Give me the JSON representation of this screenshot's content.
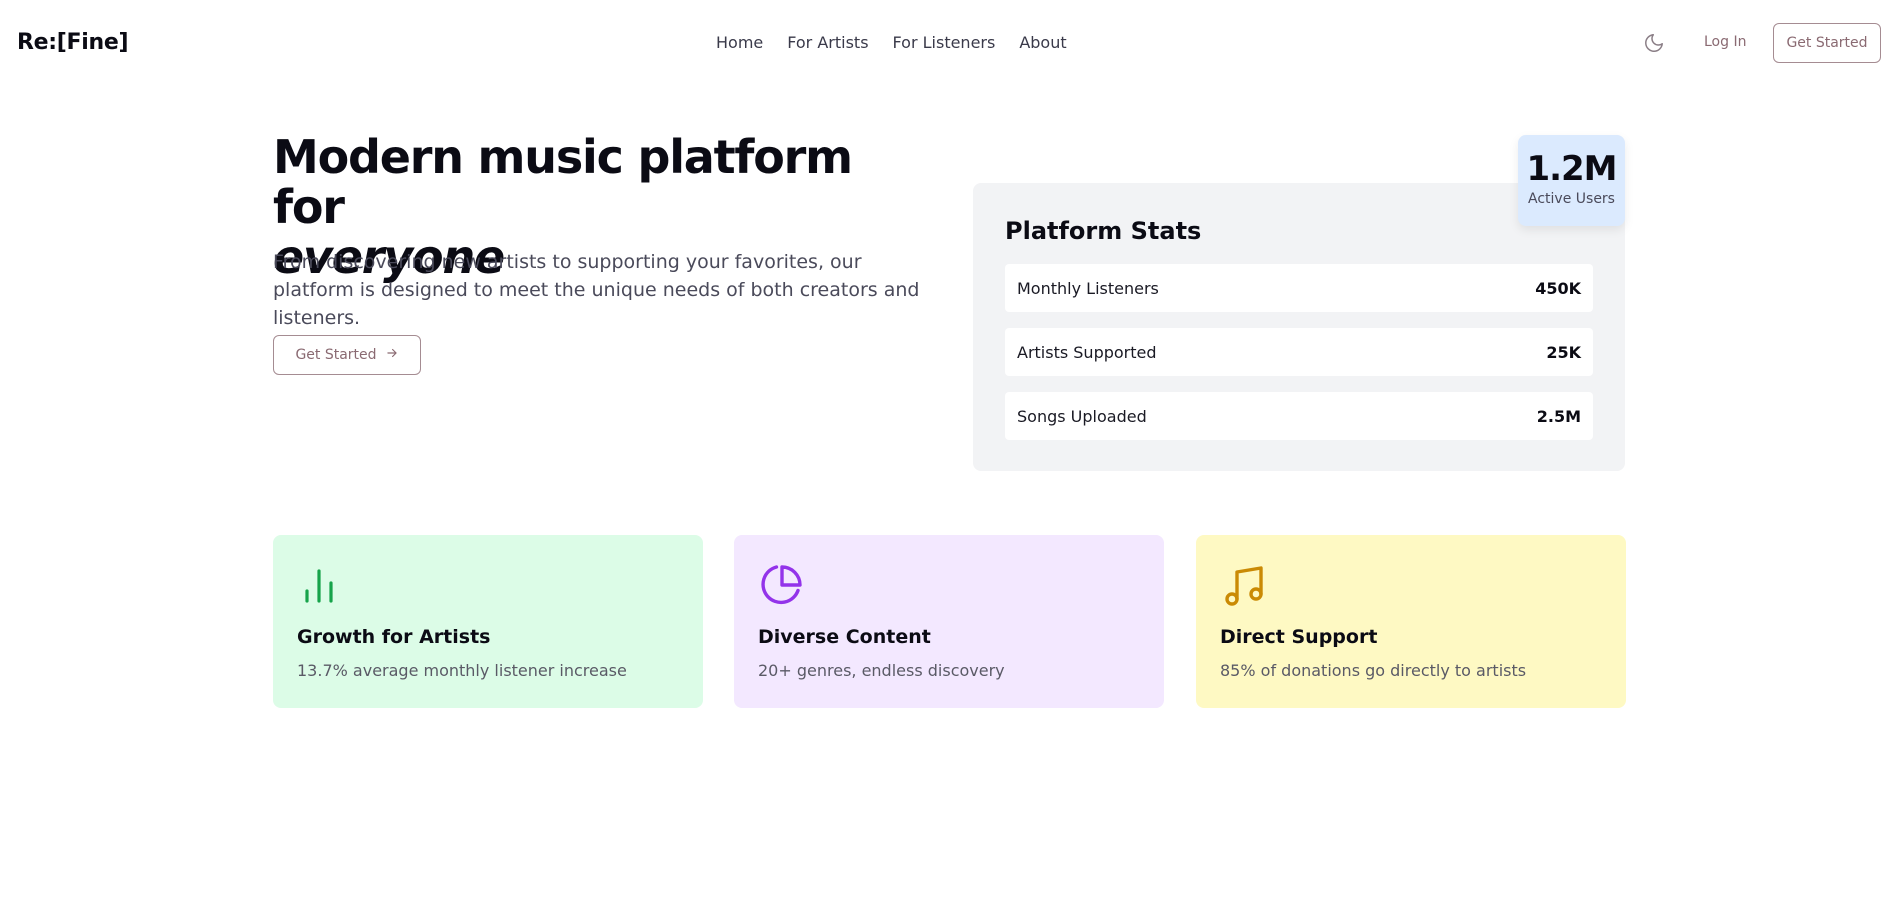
{
  "header": {
    "logo": "Re:[Fine]",
    "nav": [
      "Home",
      "For Artists",
      "For Listeners",
      "About"
    ],
    "theme_icon": "moon-icon",
    "login_label": "Log In",
    "cta_label": "Get Started"
  },
  "hero": {
    "title_main": "Modern music platform for",
    "title_emphasis": "everyone",
    "subtitle": "From discovering new artists to supporting your favorites, our platform is designed to meet the unique needs of both creators and listeners.",
    "cta_label": "Get Started",
    "cta_icon": "arrow-right-icon"
  },
  "stats": {
    "title": "Platform Stats",
    "rows": [
      {
        "label": "Monthly Listeners",
        "value": "450K"
      },
      {
        "label": "Artists Supported",
        "value": "25K"
      },
      {
        "label": "Songs Uploaded",
        "value": "2.5M"
      }
    ],
    "badge": {
      "value": "1.2M",
      "label": "Active Users",
      "color": "#dbeafe"
    }
  },
  "features": [
    {
      "icon": "bar-chart-icon",
      "title": "Growth for Artists",
      "description": "13.7% average monthly listener increase",
      "color": "#dcfce7",
      "icon_color": "#16a34a"
    },
    {
      "icon": "pie-chart-icon",
      "title": "Diverse Content",
      "description": "20+ genres, endless discovery",
      "color": "#f3e8ff",
      "icon_color": "#9333ea"
    },
    {
      "icon": "music-note-icon",
      "title": "Direct Support",
      "description": "85% of donations go directly to artists",
      "color": "#fef9c3",
      "icon_color": "#ca8a04"
    }
  ]
}
